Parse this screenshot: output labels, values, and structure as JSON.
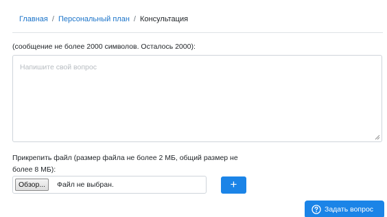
{
  "breadcrumb": {
    "items": [
      "Главная",
      "Персональный план"
    ],
    "separator": "/",
    "current": "Консультация"
  },
  "message": {
    "hint": "(сообщение не более 2000 символов. Осталось 2000):",
    "placeholder": "Напишите свой вопрос",
    "value": ""
  },
  "attach": {
    "label": "Прикрепить файл (размер файла не более 2 МБ, общий размер не более 8 МБ):",
    "browse_label": "Обзор...",
    "file_status": "Файл не выбран.",
    "add_label": "+"
  },
  "submit": {
    "label": "Задать вопрос",
    "icon": "question-circle-icon"
  },
  "colors": {
    "accent": "#1b84e7",
    "link": "#1a73c9",
    "border": "#ced4da"
  }
}
